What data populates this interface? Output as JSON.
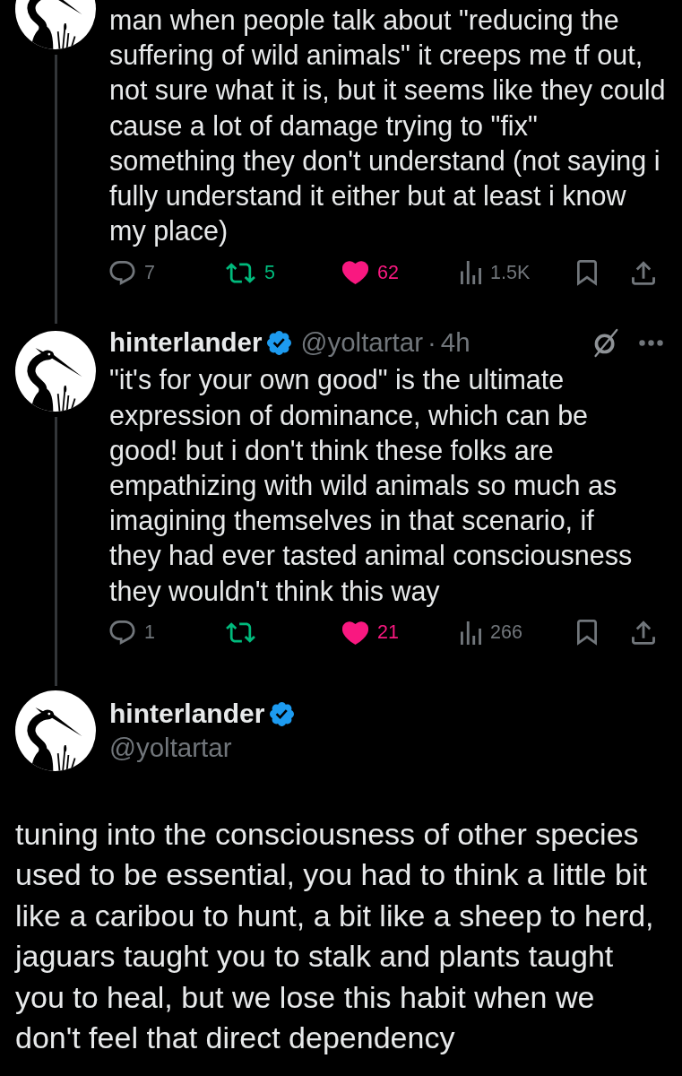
{
  "thread": [
    {
      "text": "man when people talk about \"reducing the suffering of wild animals\" it creeps me tf out, not sure what it is, but it seems like they could cause a lot of damage trying to \"fix\"\nsomething they don't understand (not saying i fully understand it either but at least i know my place)",
      "thread_line": true,
      "actions": [
        {
          "kind": "reply",
          "count": "7",
          "active": false
        },
        {
          "kind": "repost",
          "count": "5",
          "active": true
        },
        {
          "kind": "like",
          "count": "62",
          "active": true
        },
        {
          "kind": "views",
          "count": "1.5K",
          "active": false
        },
        {
          "kind": "bookmark",
          "active": false
        },
        {
          "kind": "share",
          "active": false
        }
      ]
    },
    {
      "author": {
        "name": "hinterlander",
        "verified": true,
        "handle": "@yoltartar",
        "separator": "·",
        "time": "4h"
      },
      "text": "\"it's for your own good\" is the ultimate expression of dominance, which can be good! but i don't think these folks are empathizing with wild animals so much as imagining themselves in that scenario, if they had ever tasted animal consciousness they wouldn't think this way",
      "thread_line": true,
      "actions": [
        {
          "kind": "reply",
          "count": "1",
          "active": false
        },
        {
          "kind": "repost",
          "active": true
        },
        {
          "kind": "like",
          "count": "21",
          "active": true
        },
        {
          "kind": "views",
          "count": "266",
          "active": false
        },
        {
          "kind": "bookmark",
          "active": false
        },
        {
          "kind": "share",
          "active": false
        }
      ]
    }
  ],
  "main_post": {
    "author": {
      "name": "hinterlander",
      "verified": true,
      "handle": "@yoltartar"
    },
    "text": "tuning into the consciousness of other species used to be essential, you had to think a little bit like a caribou to hunt, a bit like a sheep to herd, jaguars taught you to stalk and plants taught you to heal, but we lose this habit when we don't feel that direct dependency"
  }
}
